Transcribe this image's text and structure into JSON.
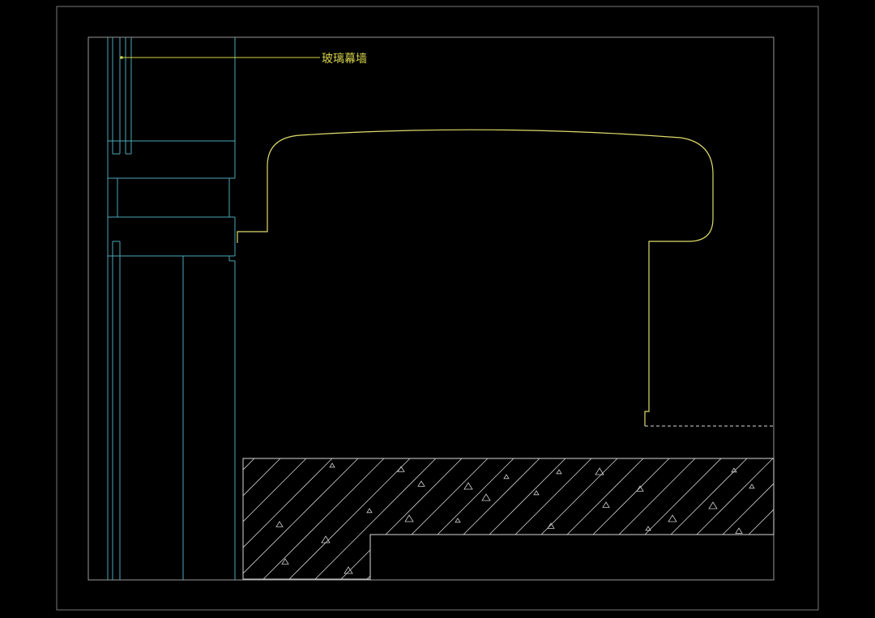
{
  "drawing": {
    "callout": {
      "label": "玻璃幕墙"
    },
    "colors": {
      "background": "#000000",
      "frame": "#8a8a8a",
      "mullion": "#4aa8b8",
      "profile": "#e0dc6a",
      "hatch": "#d8d8d8",
      "callout": "#d6d24a"
    }
  }
}
